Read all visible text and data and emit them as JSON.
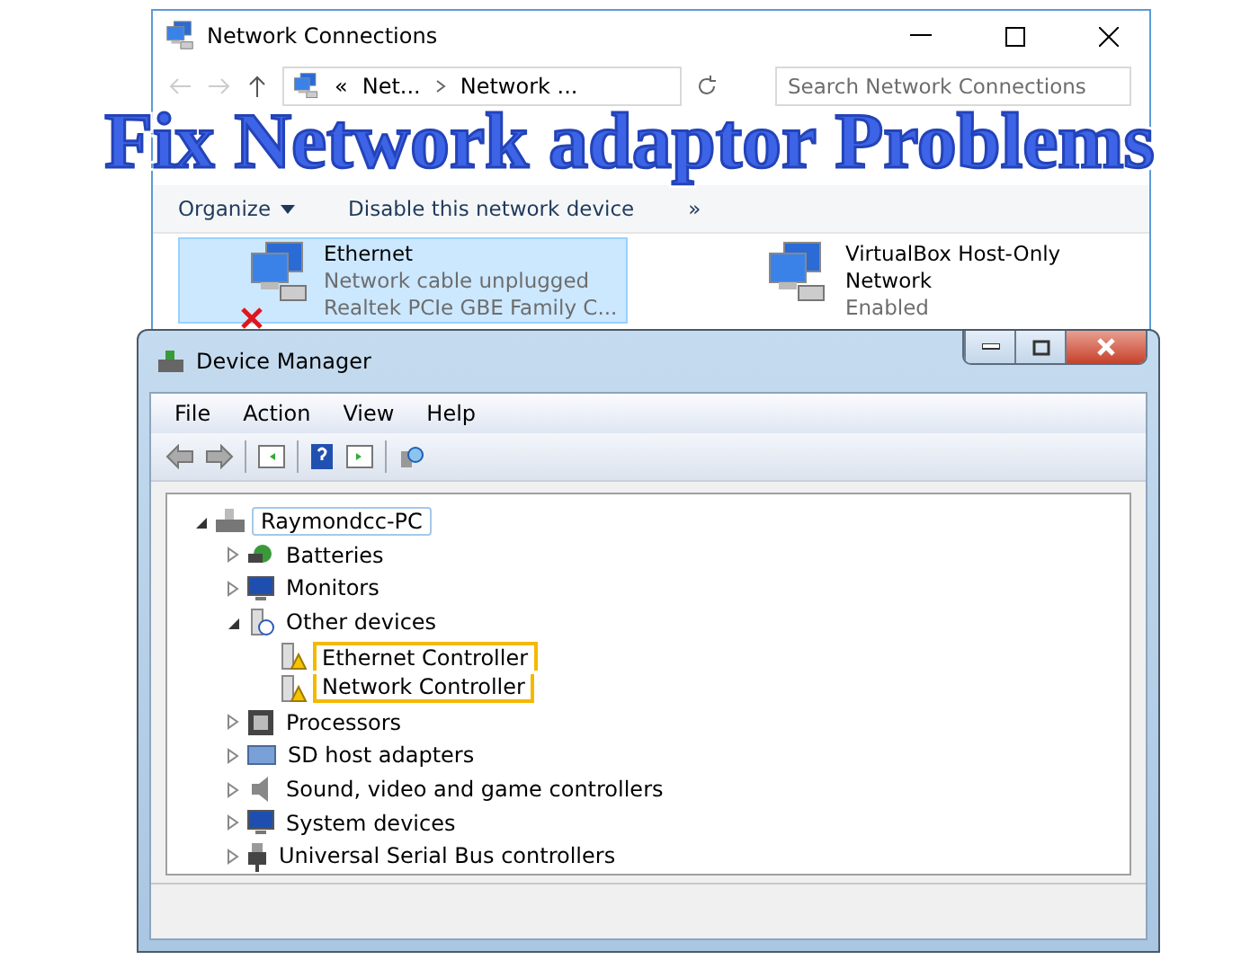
{
  "headline": "Fix Network adaptor Problems",
  "network_connections": {
    "title": "Network Connections",
    "breadcrumb": [
      "Net...",
      "Network ..."
    ],
    "breadcrumb_prefix": "«",
    "search": {
      "placeholder": "Search Network Connections"
    },
    "commands": [
      {
        "label": "Organize",
        "dropdown": true
      },
      {
        "label": "Disable this network device",
        "dropdown": false
      }
    ],
    "more": "»",
    "adapters": [
      {
        "name": "Ethernet",
        "status": "Network cable unplugged",
        "device": "Realtek PCIe GBE Family C...",
        "selected": true,
        "connected": false
      },
      {
        "name": "VirtualBox Host-Only Network",
        "status": "Enabled",
        "selected": false,
        "connected": true
      }
    ]
  },
  "device_manager": {
    "title": "Device Manager",
    "menu": [
      "File",
      "Action",
      "View",
      "Help"
    ],
    "tree": [
      {
        "label": "Raymondcc-PC",
        "kind": "computer",
        "expanded": true,
        "children": [
          {
            "label": "Batteries",
            "kind": "battery",
            "expanded": false
          },
          {
            "label": "Monitors",
            "kind": "monitor",
            "expanded": false
          },
          {
            "label": "Other devices",
            "kind": "unknown",
            "expanded": true,
            "children": [
              {
                "label": "Ethernet Controller",
                "kind": "warning",
                "highlighted": true
              },
              {
                "label": "Network Controller",
                "kind": "warning",
                "highlighted": true
              }
            ]
          },
          {
            "label": "Processors",
            "kind": "chip",
            "expanded": false
          },
          {
            "label": "SD host adapters",
            "kind": "card",
            "expanded": false
          },
          {
            "label": "Sound, video and game controllers",
            "kind": "speaker",
            "expanded": false
          },
          {
            "label": "System devices",
            "kind": "monitor",
            "expanded": false
          },
          {
            "label": "Universal Serial Bus controllers",
            "kind": "usb",
            "expanded": false
          }
        ]
      }
    ]
  }
}
